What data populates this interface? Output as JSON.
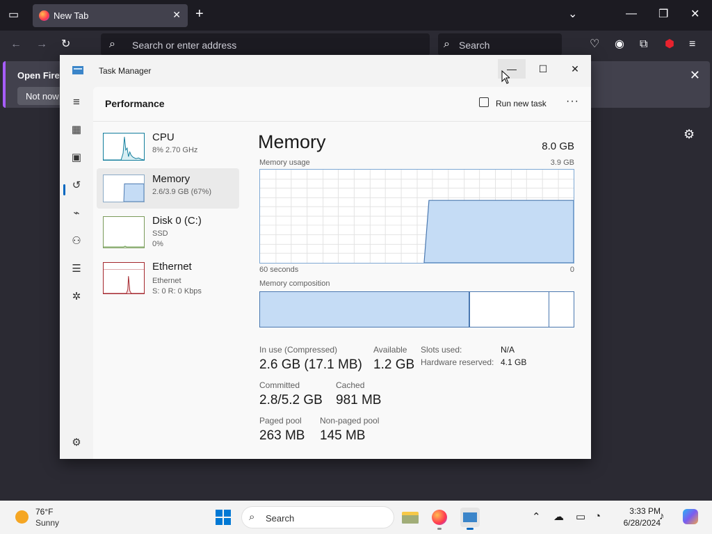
{
  "browser": {
    "tab_title": "New Tab",
    "tab_close": "✕",
    "new_tab": "+",
    "address_placeholder": "Search or enter address",
    "search_placeholder": "Search",
    "notification": {
      "message": "Open Firefo",
      "button": "Not now"
    }
  },
  "task_manager": {
    "title": "Task Manager",
    "window_buttons": {
      "minimize": "—",
      "maximize": "☐",
      "close": "✕"
    },
    "header": {
      "page_title": "Performance",
      "run_new_task": "Run new task",
      "more": "···"
    },
    "nav_icons": [
      "hamburger-icon",
      "processes-icon",
      "performance-icon",
      "app-history-icon",
      "startup-apps-icon",
      "users-icon",
      "details-icon",
      "services-icon",
      "settings-icon"
    ],
    "resources": [
      {
        "name": "CPU",
        "lines": [
          "8% 2.70 GHz"
        ]
      },
      {
        "name": "Memory",
        "lines": [
          "2.6/3.9 GB (67%)"
        ]
      },
      {
        "name": "Disk 0 (C:)",
        "lines": [
          "SSD",
          "0%"
        ]
      },
      {
        "name": "Ethernet",
        "lines": [
          "Ethernet",
          "S: 0 R: 0 Kbps"
        ]
      }
    ],
    "memory": {
      "heading": "Memory",
      "total": "8.0 GB",
      "usage_label": "Memory usage",
      "usage_max": "3.9 GB",
      "time_left": "60 seconds",
      "time_right": "0",
      "usage_fraction": 0.67,
      "composition_label": "Memory composition",
      "composition": {
        "in_use": 2.6,
        "standby": 0.98,
        "free": 0.3
      },
      "stats": {
        "in_use_label": "In use (Compressed)",
        "in_use_value": "2.6 GB (17.1 MB)",
        "available_label": "Available",
        "available_value": "1.2 GB",
        "committed_label": "Committed",
        "committed_value": "2.8/5.2 GB",
        "cached_label": "Cached",
        "cached_value": "981 MB",
        "paged_label": "Paged pool",
        "paged_value": "263 MB",
        "nonpaged_label": "Non-paged pool",
        "nonpaged_value": "145 MB",
        "slots_label": "Slots used:",
        "slots_value": "N/A",
        "hw_reserved_label": "Hardware reserved:",
        "hw_reserved_value": "4.1 GB"
      }
    }
  },
  "taskbar": {
    "weather_temp": "76°F",
    "weather_condition": "Sunny",
    "search_placeholder": "Search",
    "time": "3:33 PM",
    "date": "6/28/2024"
  },
  "colors": {
    "accent": "#0067c0",
    "memory_fill": "#c5dcf5",
    "memory_line": "#4a78b0",
    "cpu_line": "#117d9c",
    "ethernet_line": "#a4262c"
  }
}
